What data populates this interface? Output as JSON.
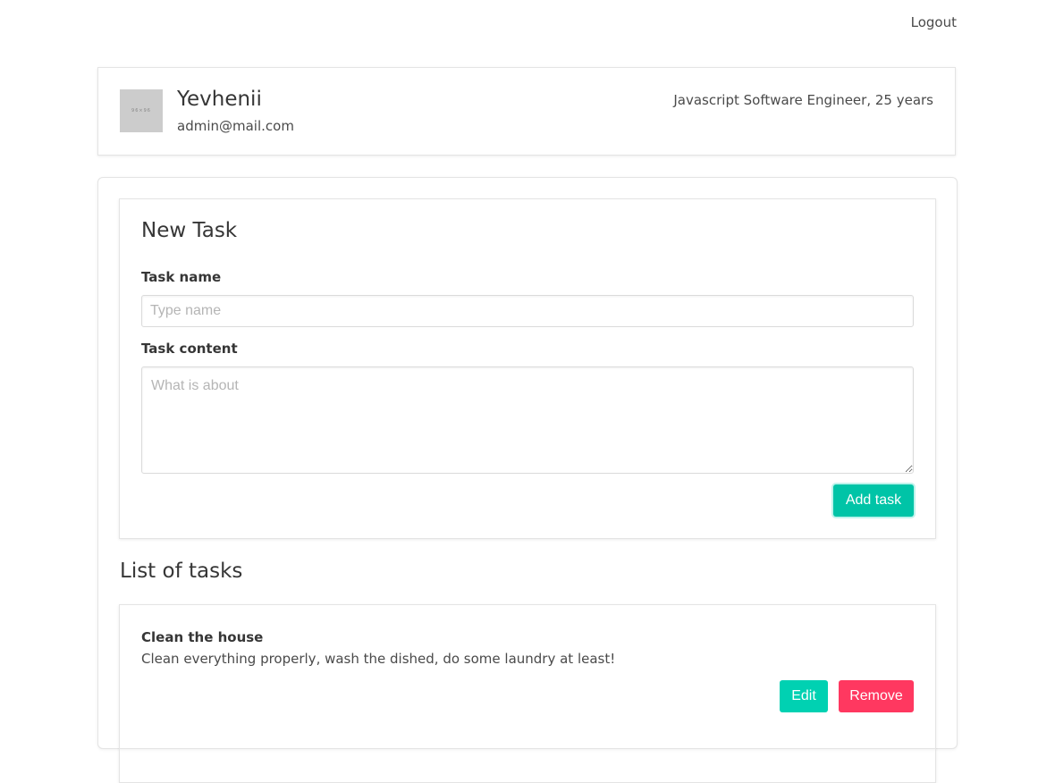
{
  "header": {
    "logout_label": "Logout"
  },
  "profile": {
    "avatar_text": "96×96",
    "name": "Yevhenii",
    "email": "admin@mail.com",
    "role": "Javascript Software Engineer, 25 years"
  },
  "new_task": {
    "title": "New Task",
    "name_label": "Task name",
    "name_placeholder": "Type name",
    "name_value": "",
    "content_label": "Task content",
    "content_placeholder": "What is about",
    "content_value": "",
    "add_button": "Add task"
  },
  "task_list": {
    "title": "List of tasks",
    "items": [
      {
        "name": "Clean the house",
        "content": "Clean everything properly, wash the dished, do some laundry at least!",
        "edit_label": "Edit",
        "remove_label": "Remove"
      }
    ]
  },
  "colors": {
    "primary": "#00d1b2",
    "danger": "#ff3860"
  }
}
